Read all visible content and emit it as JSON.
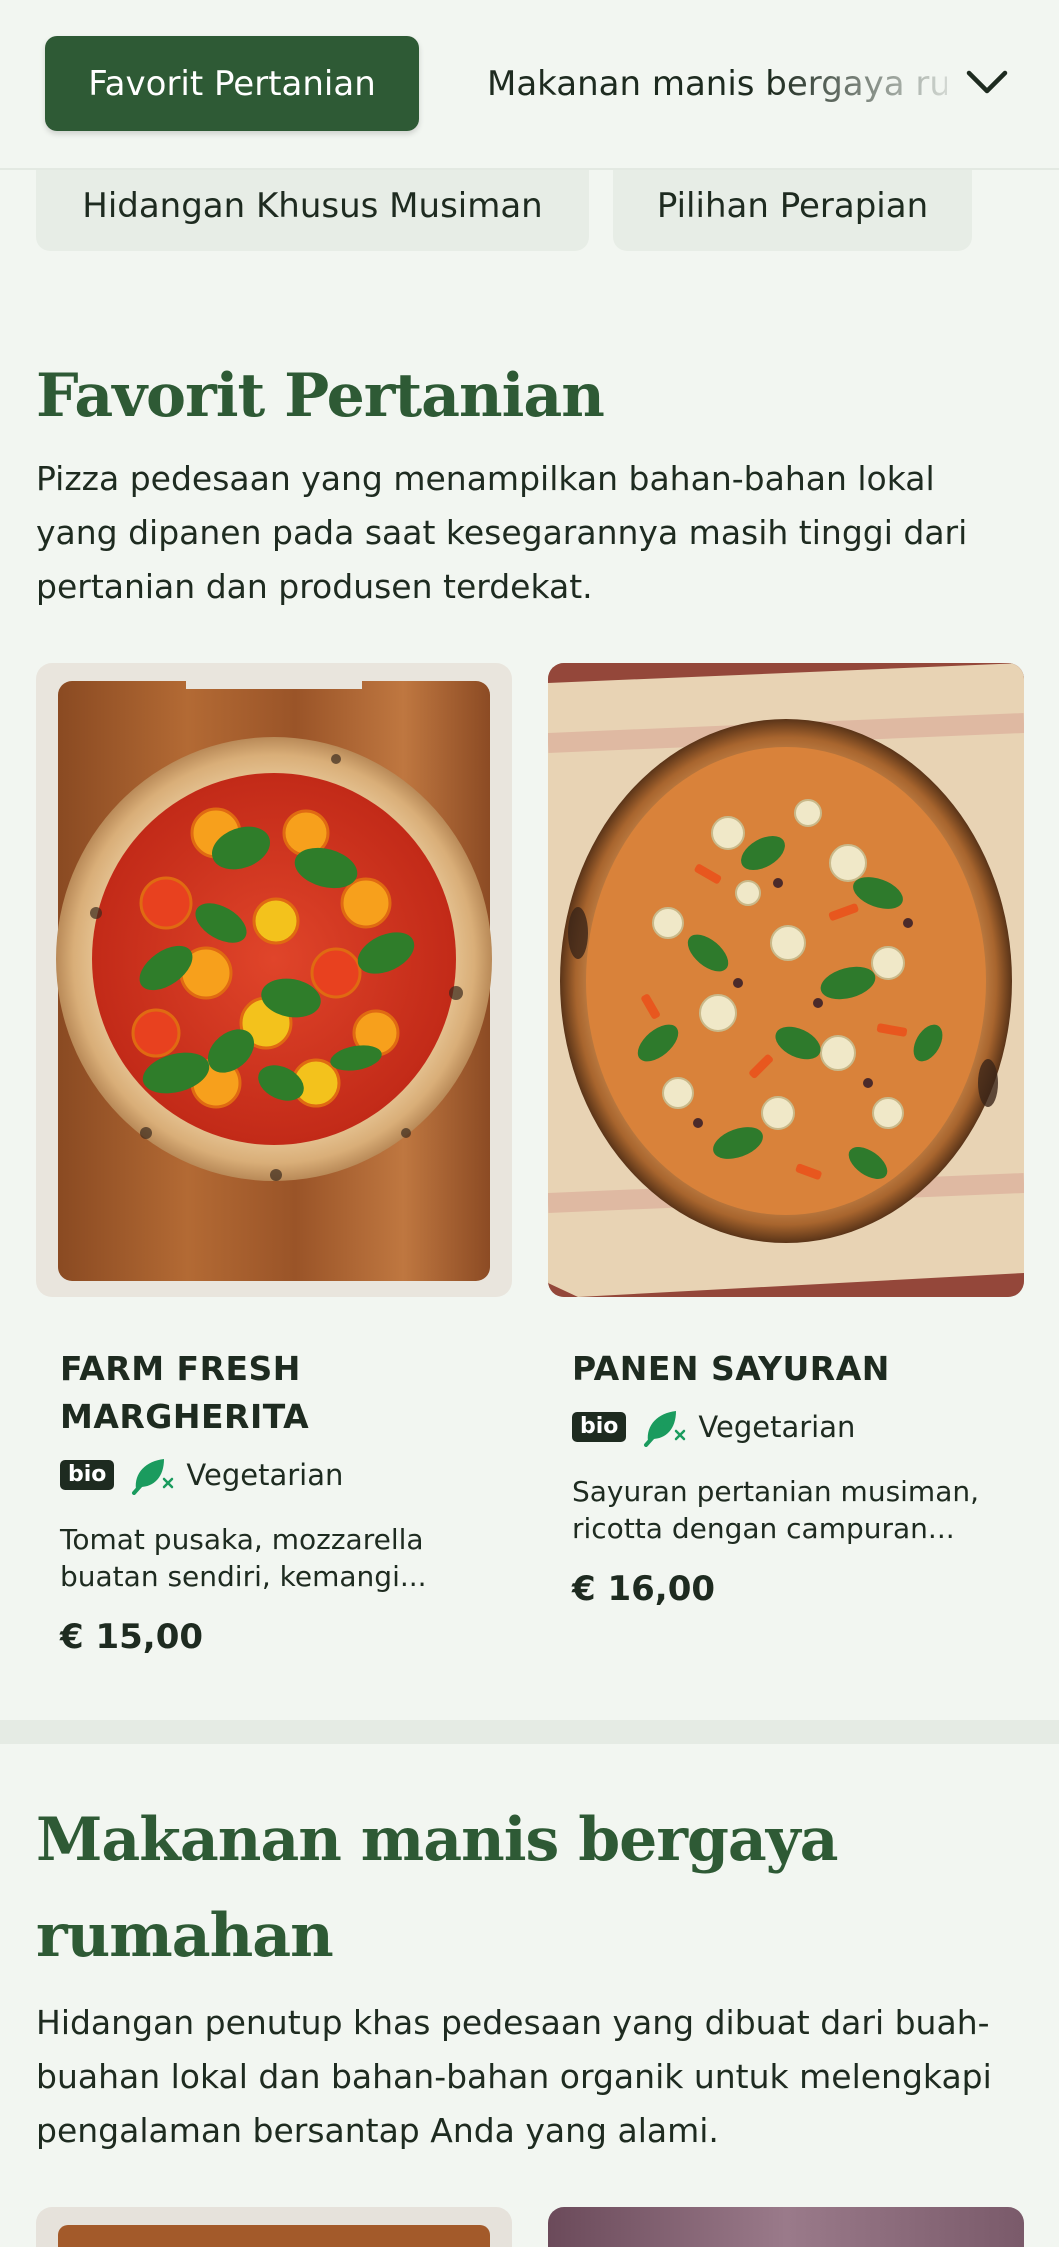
{
  "nav": {
    "active_tab": "Favorit Pertanian",
    "next_tab": "Makanan manis bergaya rumahan",
    "chips": [
      "Hidangan Khusus Musiman",
      "Pilihan Perapian"
    ]
  },
  "section1": {
    "title": "Favorit Pertanian",
    "description": "Pizza pedesaan yang menampilkan bahan-bahan lokal yang dipanen pada saat kesegarannya masih tinggi dari pertanian dan produsen terdekat."
  },
  "products": [
    {
      "name": "FARM FRESH MARGHERITA",
      "badge": "bio",
      "diet": "Vegetarian",
      "description": "Tomat pusaka, mozzarella buatan sendiri, kemangi...",
      "price": "€ 15,00"
    },
    {
      "name": "PANEN SAYURAN",
      "badge": "bio",
      "diet": "Vegetarian",
      "description": "Sayuran pertanian musiman, ricotta dengan campuran...",
      "price": "€ 16,00"
    }
  ],
  "section2": {
    "title": "Makanan manis bergaya rumahan",
    "description": "Hidangan penutup khas pedesaan yang dibuat dari buah-buahan lokal dan bahan-bahan organik untuk melengkapi pengalaman bersantap Anda yang alami."
  },
  "colors": {
    "accent": "#2e5a35",
    "background": "#f2f6f1",
    "chip": "#e7ede6",
    "leaf": "#1a9b5e"
  },
  "icons": [
    "chevron-down-icon",
    "leaf-vegetarian-icon"
  ]
}
